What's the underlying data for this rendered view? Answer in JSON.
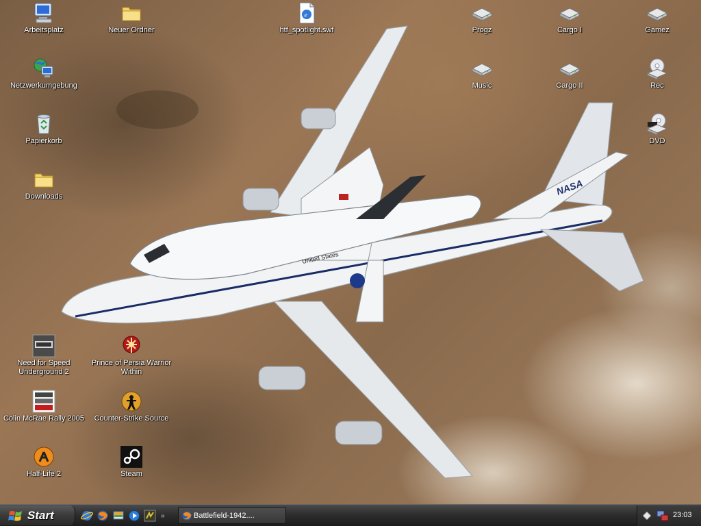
{
  "desktop": {
    "icons": {
      "arbeitsplatz": "Arbeitsplatz",
      "neuer_ordner": "Neuer Ordner",
      "htf_spotlight": "htf_spotlight.swf",
      "progz": "Progz",
      "cargo1": "Cargo I",
      "gamez": "Gamez",
      "netzwerk": "Netzwerkumgebung",
      "music": "Music",
      "cargo2": "Cargo II",
      "rec": "Rec",
      "papierkorb": "Papierkorb",
      "dvd": "DVD",
      "downloads": "Downloads",
      "nfs": "Need for Speed Underground 2",
      "pop": "Prince of Persia Warrior Within",
      "colin": "Colin McRae Rally 2005",
      "css": "Counter-Strike Source",
      "hl2": "Half-Life 2",
      "steam": "Steam"
    },
    "wallpaper_text": {
      "nasa": "NASA",
      "us": "United States"
    }
  },
  "taskbar": {
    "start_label": "Start",
    "more_label": "»",
    "tasks": [
      {
        "label": "Battlefield-1942...."
      }
    ],
    "clock": "23:03"
  },
  "colors": {
    "taskbar": "#2e2e2e",
    "icon_label": "#ffffff",
    "desert": "#8a6a4c"
  }
}
